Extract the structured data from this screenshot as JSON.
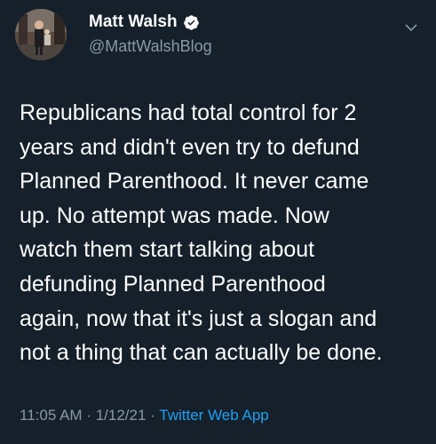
{
  "tweet": {
    "author": {
      "name": "Matt Walsh",
      "handle": "@MattWalshBlog",
      "verified": true
    },
    "text_lines": [
      "Republicans had total control for 2",
      "years and didn't even try to defund",
      "Planned Parenthood. It never came",
      "up. No attempt was made. Now",
      "watch them start talking about",
      "defunding Planned Parenthood",
      "again, now that it's just a slogan and",
      "not a thing that can actually be done."
    ],
    "time": "11:05 AM",
    "separator": "·",
    "date": "1/12/21",
    "source": "Twitter Web App"
  },
  "icons": {
    "verified": "verified-badge-icon",
    "menu": "chevron-down-icon"
  },
  "colors": {
    "background": "#15202b",
    "text": "#ffffff",
    "secondary": "#8899a6",
    "accent": "#1da1f2"
  }
}
